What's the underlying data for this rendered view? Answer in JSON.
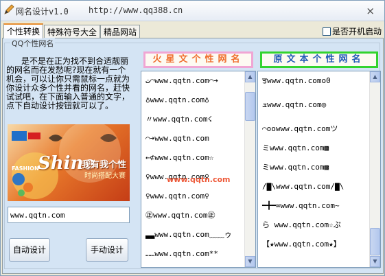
{
  "window": {
    "title": "网名设计v1.0",
    "url": "http://www.qq388.cn",
    "close_glyph": "×"
  },
  "tabs": [
    {
      "label": "个性转换",
      "active": true
    },
    {
      "label": "特殊符号大全",
      "active": false
    },
    {
      "label": "精品网站",
      "active": false
    }
  ],
  "autostart": {
    "label": "是否开机启动",
    "checked": false
  },
  "group": {
    "legend": "QQ个性网名"
  },
  "description": "是不是在正为找不到合适靓丽的网名而在发愁呢?现在就有一个机会，可以让你只需鼠标一点就为你设计众多个性并看的网名，赶快试试吧，在下面输入普通的文字，点下自动设计按钮就可以了。",
  "banner": {
    "main_text": "Shine",
    "sub_text": "我有我个性",
    "sub_text2": "时尚搭配大赛",
    "label": "FASHION"
  },
  "input": {
    "value": "www.qqtn.com"
  },
  "buttons": {
    "auto": "自动设计",
    "manual": "手动设计"
  },
  "headers": {
    "left": "火星文个性网名",
    "right": "原文本个性网名"
  },
  "watermark": "www.qqtn.com",
  "left_list": [
    "ت⌒www.qqtn.com⌒➔",
    "♁www.qqtn.com♁",
    "〃www.qqtn.com☇",
    "⌒➔www.qqtn.com",
    "←⊄www.qqtn.com☆",
    "♀www.qqtn.com♀",
    "♀www.qqtn.com♀",
    "㊣www.qqtn.com㊣",
    "▃▃www.qqtn.com﹏﹏ゥ",
    "……www.qqtn.com**"
  ],
  "right_list": [
    "ਤwww.qqtn.como0",
    "ܫwww.qqtn.com◎",
    "⌒oowww.qqtn.comツ",
    "ミwww.qqtn.com▩",
    "ミwww.qqtn.com▩",
    "/▇\\www.qqtn.com/▇\\",
    "━╋━∞www.qqtn.com~",
    "ら www.qqtn.com☆ぷ",
    "【★www.qqtn.com★】"
  ],
  "colors": {
    "left_header_border": "#f0a6d4",
    "left_header_text": "#ef6c2b",
    "right_header_border": "#32d32e",
    "right_header_text": "#1f59b6",
    "tab_accent": "#e68b2c"
  }
}
